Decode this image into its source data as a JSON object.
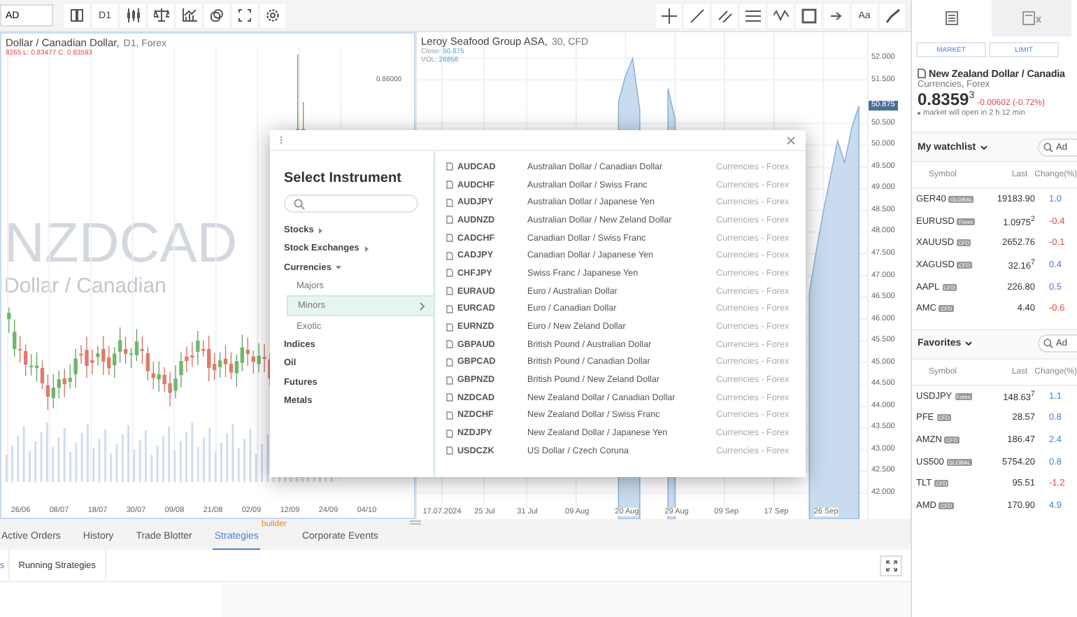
{
  "toolbar": {
    "symbol_value": "AD",
    "interval": "D1",
    "drawing_tools": [
      {
        "kind": "crosshair"
      },
      {
        "kind": "line"
      },
      {
        "kind": "parallel"
      },
      {
        "kind": "levels"
      },
      {
        "kind": "wave"
      },
      {
        "kind": "rectangle"
      },
      {
        "kind": "arrow"
      },
      {
        "kind": "text",
        "label": "Aa"
      },
      {
        "kind": "brush"
      }
    ]
  },
  "left_chart": {
    "title": "Dollar / Canadian Dollar,",
    "meta": "D1, Forex",
    "ohlc": "8265 L: 0.83477 C: 0.83593",
    "watermark_symbol": "NZDCAD",
    "watermark_name": "Dollar / Canadian",
    "y_label": "0.86000",
    "x_labels": [
      "26/06",
      "08/07",
      "18/07",
      "30/07",
      "09/08",
      "21/08",
      "02/09",
      "12/09",
      "24/09",
      "04/10"
    ]
  },
  "right_chart": {
    "title": "Leroy Seafood Group ASA,",
    "meta": "30, CFD",
    "price_tag": "50.875",
    "lines": [
      {
        "label": "Close:",
        "value": "50.875"
      },
      {
        "label": "VOL:",
        "value": "26856"
      }
    ],
    "chart_data": {
      "type": "area",
      "categories": [
        "17.07.2024",
        null,
        null,
        null,
        null,
        null,
        "25 Jul",
        null,
        null,
        null,
        null,
        null,
        "31 Jul",
        null,
        null,
        null,
        null,
        null,
        null,
        "09 Aug",
        null,
        null,
        null,
        null,
        null,
        null,
        "20 Aug",
        null,
        null,
        null,
        null,
        null,
        null,
        "29 Aug",
        null,
        null,
        null,
        null,
        null,
        null,
        "09 Sep",
        null,
        null,
        null,
        null,
        null,
        null,
        "17 Sep",
        null,
        null,
        null,
        null,
        null,
        null,
        "26 Sep",
        null,
        null,
        null,
        null,
        null
      ],
      "series": [
        {
          "color": "#8fb2d6",
          "values": [
            null,
            null,
            null,
            null,
            null,
            null,
            null,
            null,
            null,
            null,
            null,
            null,
            null,
            null,
            null,
            null,
            null,
            null,
            null,
            null,
            null,
            null,
            null,
            null,
            null,
            51.0,
            51.6,
            52.0,
            50.8,
            null,
            null,
            null,
            51.3,
            50.6,
            null,
            null,
            null,
            null,
            null,
            null,
            null,
            null,
            null,
            null,
            null,
            null,
            null,
            null,
            null,
            null,
            null,
            null,
            46.6,
            47.6,
            48.5,
            49.3,
            50.1,
            49.6,
            50.4,
            50.9
          ]
        }
      ],
      "ylim": [
        41.4,
        52.6
      ],
      "grid": true,
      "yticks": [
        {
          "value": 42,
          "label": "42.000"
        },
        {
          "value": 42.5,
          "label": "42.500"
        },
        {
          "value": 43,
          "label": "43.000"
        },
        {
          "value": 43.5,
          "label": "43.500"
        },
        {
          "value": 44,
          "label": "44.000"
        },
        {
          "value": 44.5,
          "label": "44.500"
        },
        {
          "value": 45,
          "label": "45.000"
        },
        {
          "value": 45.5,
          "label": "45.500"
        },
        {
          "value": 46,
          "label": "46.000"
        },
        {
          "value": 46.5,
          "label": "46.500"
        },
        {
          "value": 47,
          "label": "47.000"
        },
        {
          "value": 47.5,
          "label": "47.500"
        },
        {
          "value": 48,
          "label": "48.000"
        },
        {
          "value": 48.5,
          "label": "48.500"
        },
        {
          "value": 49,
          "label": "49.000"
        },
        {
          "value": 49.5,
          "label": "49.500"
        },
        {
          "value": 50,
          "label": "50.000"
        },
        {
          "value": 50.5,
          "label": "50.500"
        },
        {
          "value": 51.5,
          "label": "51.500"
        },
        {
          "value": 52,
          "label": "52.000"
        }
      ]
    }
  },
  "dialog": {
    "title": "Select Instrument",
    "categories": [
      {
        "label": "Stocks",
        "kind": "folder",
        "expanded": false
      },
      {
        "label": "Stock Exchanges",
        "kind": "folder",
        "expanded": false
      },
      {
        "label": "Currencies",
        "kind": "folder",
        "expanded": true,
        "children": [
          {
            "label": "Majors",
            "selected": false
          },
          {
            "label": "Minors",
            "selected": true
          },
          {
            "label": "Exotic",
            "selected": false
          }
        ]
      },
      {
        "label": "Indices",
        "kind": "item"
      },
      {
        "label": "Oil",
        "kind": "item"
      },
      {
        "label": "Futures",
        "kind": "item"
      },
      {
        "label": "Metals",
        "kind": "item"
      }
    ],
    "instruments": [
      {
        "symbol": "AUDCAD",
        "name": "Australian Dollar / Canadian Dollar",
        "category": "Currencies - Forex"
      },
      {
        "symbol": "AUDCHF",
        "name": "Australian Dollar / Swiss Franc",
        "category": "Currencies - Forex"
      },
      {
        "symbol": "AUDJPY",
        "name": "Australian Dollar / Japanese Yen",
        "category": "Currencies - Forex"
      },
      {
        "symbol": "AUDNZD",
        "name": "Australian Dollar / New Zeland Dollar",
        "category": "Currencies - Forex"
      },
      {
        "symbol": "CADCHF",
        "name": "Canadian Dollar / Swiss Franc",
        "category": "Currencies - Forex"
      },
      {
        "symbol": "CADJPY",
        "name": "Canadian Dollar / Japanese Yen",
        "category": "Currencies - Forex"
      },
      {
        "symbol": "CHFJPY",
        "name": "Swiss Franc / Japanese Yen",
        "category": "Currencies - Forex"
      },
      {
        "symbol": "EURAUD",
        "name": "Euro / Australian Dollar",
        "category": "Currencies - Forex"
      },
      {
        "symbol": "EURCAD",
        "name": "Euro / Canadian Dollar",
        "category": "Currencies - Forex"
      },
      {
        "symbol": "EURNZD",
        "name": "Euro / New Zeland Dollar",
        "category": "Currencies - Forex"
      },
      {
        "symbol": "GBPAUD",
        "name": "British Pound / Australian Dollar",
        "category": "Currencies - Forex"
      },
      {
        "symbol": "GBPCAD",
        "name": "British Pound / Canadian Dollar",
        "category": "Currencies - Forex"
      },
      {
        "symbol": "GBPNZD",
        "name": "British Pound / New Zeland Dollar",
        "category": "Currencies - Forex"
      },
      {
        "symbol": "NZDCAD",
        "name": "New Zealand Dollar / Canadian Dollar",
        "category": "Currencies - Forex"
      },
      {
        "symbol": "NZDCHF",
        "name": "New Zealand Dollar / Swiss Franc",
        "category": "Currencies - Forex"
      },
      {
        "symbol": "NZDJPY",
        "name": "New Zealand Dollar / Japanese Yen",
        "category": "Currencies - Forex"
      },
      {
        "symbol": "USDCZK",
        "name": "US Dollar / Czech Coruna",
        "category": "Currencies - Forex"
      }
    ]
  },
  "bottom": {
    "tabs": [
      {
        "label": "Active Orders",
        "selected": false
      },
      {
        "label": "History",
        "selected": false
      },
      {
        "label": "Trade Blotter",
        "selected": false
      },
      {
        "label": "Strategies",
        "selected": true,
        "badge": "builder"
      },
      {
        "label": "Corporate Events",
        "selected": false
      }
    ],
    "subtabs": [
      {
        "label": "s",
        "selected": true
      },
      {
        "label": "Running Strategies",
        "selected": false
      }
    ]
  },
  "panel": {
    "tabs": [
      {
        "selected": true
      },
      {
        "selected": false
      }
    ],
    "order_types": [
      "MARKET",
      "LIMIT"
    ],
    "instrument": "New Zealand Dollar / Canadia",
    "category": "Currencies, Forex",
    "price": "0.8359",
    "price_sup": "3",
    "change": "-0.00602 (-0.72%)",
    "market_note": "market will open in 2 h 12 min",
    "lists": [
      {
        "title": "My watchlist",
        "search_placeholder": "Ad",
        "columns": [
          "Symbol",
          "Last",
          "Change(%)"
        ],
        "rows": [
          {
            "symbol": "GER40",
            "tag": "GLOBAL",
            "last": "19183.90",
            "change": "1.0",
            "color": "#4a7fe0"
          },
          {
            "symbol": "EURUSD",
            "tag": "Forex",
            "last": "1.0975$^{2}$",
            "change": "-0.4",
            "color": "#e04848"
          },
          {
            "symbol": "XAUUSD",
            "tag": "CFD",
            "last": "2652.76",
            "change": "-0.1",
            "color": "#e04848"
          },
          {
            "symbol": "XAGUSD",
            "tag": "CFD",
            "last": "32.16$^{7}$",
            "change": "0.4",
            "color": "#4a7fe0"
          },
          {
            "symbol": "AAPL",
            "tag": "CFD",
            "last": "226.80",
            "change": "0.5",
            "color": "#4a7fe0"
          },
          {
            "symbol": "AMC",
            "tag": "CFD",
            "last": "4.40",
            "change": "-0.6",
            "color": "#e04848"
          }
        ]
      },
      {
        "title": "Favorites",
        "search_placeholder": "Ad",
        "columns": [
          "Symbol",
          "Last",
          "Change(%)"
        ],
        "rows": [
          {
            "symbol": "USDJPY",
            "tag": "Forex",
            "last": "148.63$^{7}$",
            "change": "1.1",
            "color": "#4a7fe0"
          },
          {
            "symbol": "PFE",
            "tag": "CFD",
            "last": "28.57",
            "change": "0.8",
            "color": "#4a7fe0"
          },
          {
            "symbol": "AMZN",
            "tag": "CFD",
            "last": "186.47",
            "change": "2.4",
            "color": "#4a7fe0"
          },
          {
            "symbol": "US500",
            "tag": "GLOBAL",
            "last": "5754.20",
            "change": "0.8",
            "color": "#4a7fe0"
          },
          {
            "symbol": "TLT",
            "tag": "CFD",
            "last": "95.51",
            "change": "-1.2",
            "color": "#e04848"
          },
          {
            "symbol": "AMD",
            "tag": "CFD",
            "last": "170.90",
            "change": "4.9",
            "color": "#4a7fe0"
          }
        ]
      }
    ]
  }
}
